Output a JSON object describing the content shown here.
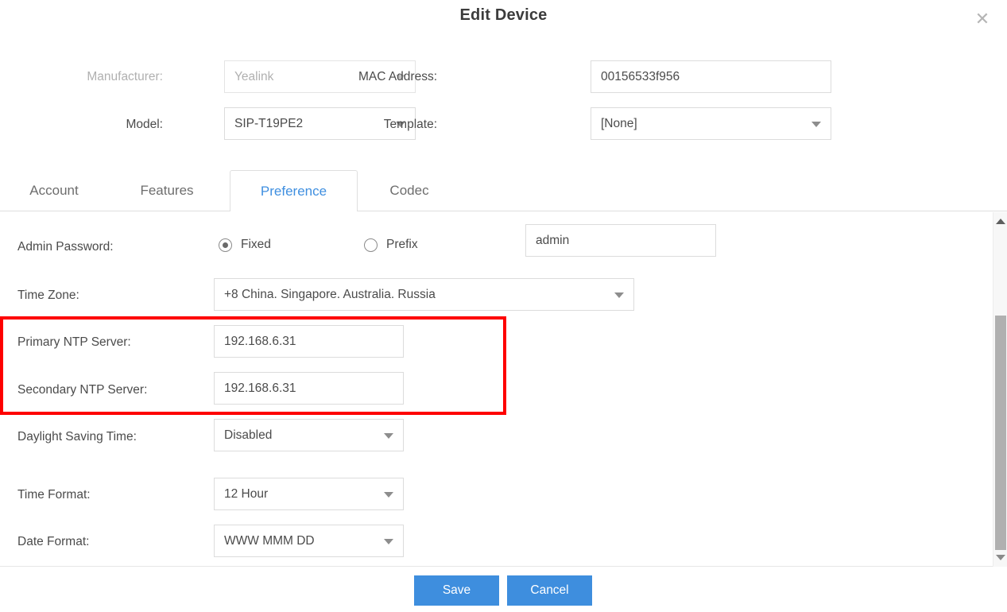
{
  "dialog": {
    "title": "Edit Device",
    "close_icon": "close-icon"
  },
  "header_form": {
    "manufacturer": {
      "label": "Manufacturer:",
      "value": "Yealink",
      "disabled": true,
      "caret_icon": "chevron-down-icon"
    },
    "mac_address": {
      "label": "MAC Address:",
      "value": "00156533f956"
    },
    "model": {
      "label": "Model:",
      "value": "SIP-T19PE2",
      "caret_icon": "chevron-down-icon"
    },
    "template": {
      "label": "Template:",
      "value": "[None]",
      "caret_icon": "chevron-down-icon"
    }
  },
  "tabs": [
    {
      "label": "Account",
      "active": false
    },
    {
      "label": "Features",
      "active": false
    },
    {
      "label": "Preference",
      "active": true
    },
    {
      "label": "Codec",
      "active": false
    }
  ],
  "preference": {
    "admin_password": {
      "label": "Admin Password:",
      "options": [
        {
          "label": "Fixed",
          "selected": true
        },
        {
          "label": "Prefix",
          "selected": false
        }
      ],
      "value": "admin"
    },
    "time_zone": {
      "label": "Time Zone:",
      "value": "+8 China. Singapore. Australia. Russia",
      "caret_icon": "chevron-down-icon"
    },
    "primary_ntp": {
      "label": "Primary NTP Server:",
      "value": "192.168.6.31"
    },
    "secondary_ntp": {
      "label": "Secondary NTP Server:",
      "value": "192.168.6.31"
    },
    "daylight_saving": {
      "label": "Daylight Saving Time:",
      "value": "Disabled",
      "caret_icon": "chevron-down-icon"
    },
    "time_format": {
      "label": "Time Format:",
      "value": "12 Hour",
      "caret_icon": "chevron-down-icon"
    },
    "date_format": {
      "label": "Date Format:",
      "value": "WWW MMM DD",
      "caret_icon": "chevron-down-icon"
    }
  },
  "scrollbar": {
    "up_icon": "triangle-up-icon",
    "down_icon": "triangle-down-icon"
  },
  "footer": {
    "save_label": "Save",
    "cancel_label": "Cancel"
  },
  "colors": {
    "accent_blue": "#3e8ede",
    "highlight_red": "#fe0000",
    "text": "#4b4b4b",
    "muted_text": "#b0b0b0",
    "border": "#dcdcdc"
  }
}
